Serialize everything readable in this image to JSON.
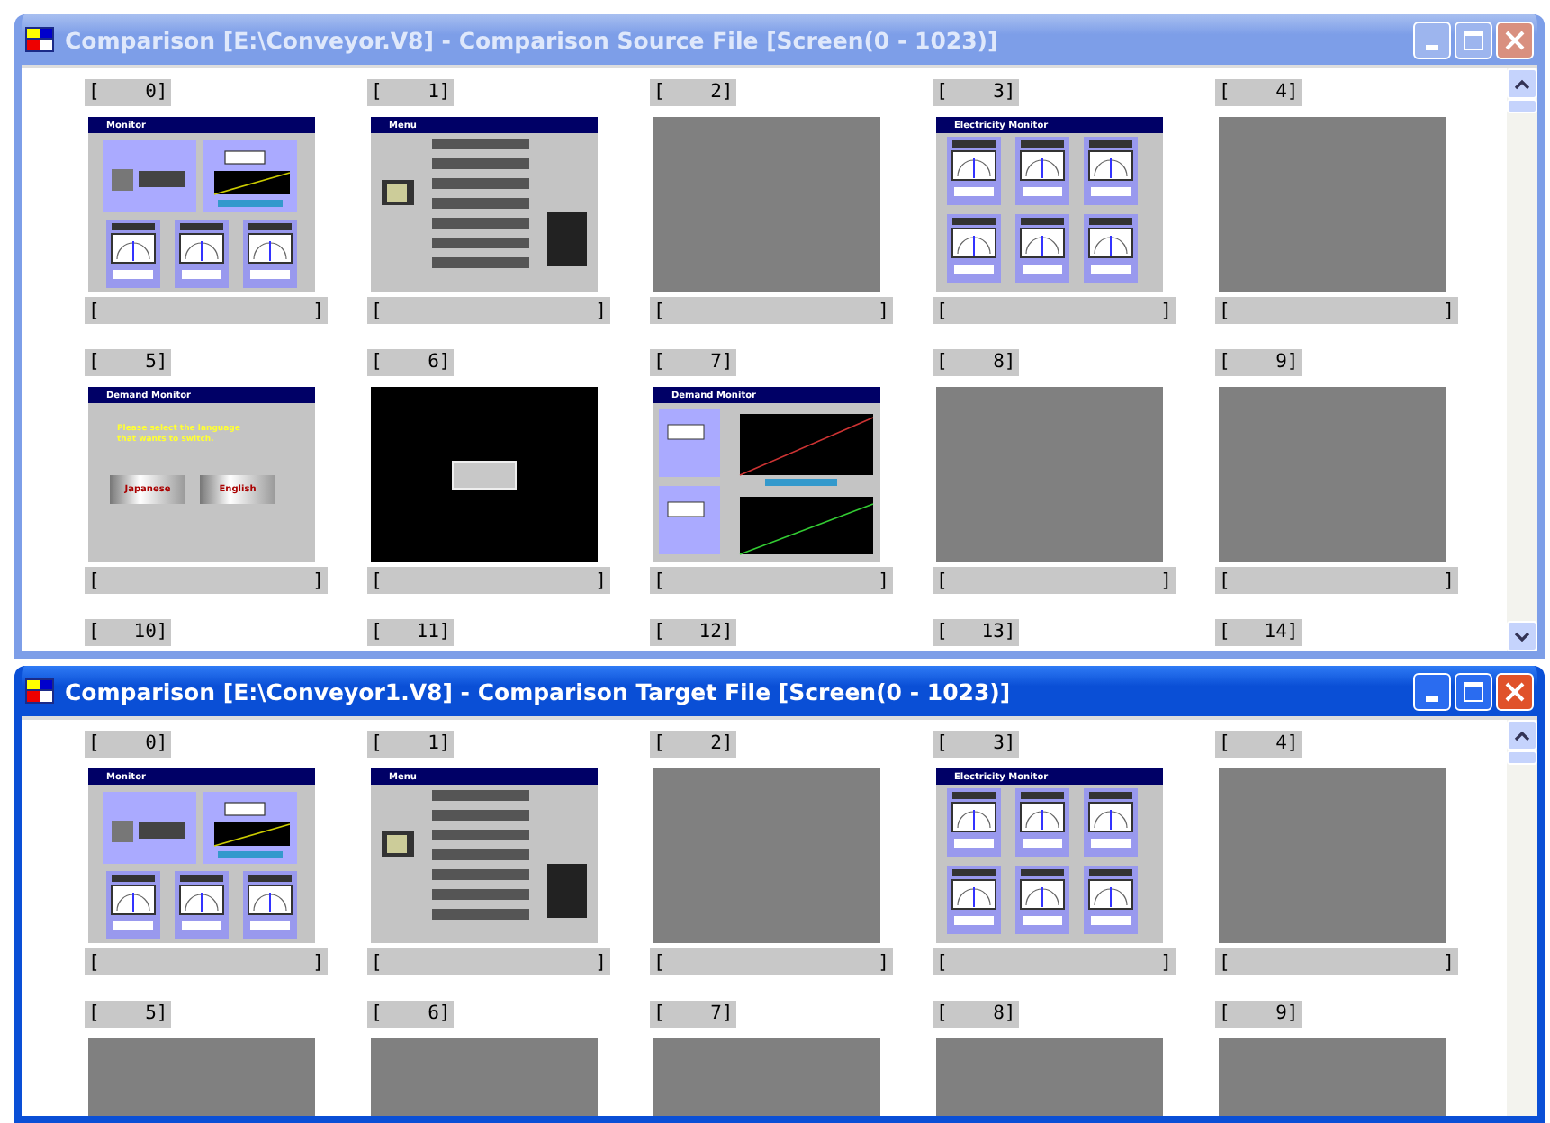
{
  "windows": [
    {
      "title": "Comparison [E:\\Conveyor.V8] - Comparison Source File [Screen(0 - 1023)]",
      "active": false,
      "scroll_down": true,
      "cells": [
        {
          "number": "[    0]",
          "kind": "monitor",
          "screen_title": "Monitor",
          "caption": {
            "open": "[",
            "close": "]"
          }
        },
        {
          "number": "[    1]",
          "kind": "menu",
          "screen_title": "Menu",
          "caption": {
            "open": "[",
            "close": "]"
          }
        },
        {
          "number": "[    2]",
          "kind": "blank",
          "caption": {
            "open": "[",
            "close": "]"
          }
        },
        {
          "number": "[    3]",
          "kind": "meters",
          "screen_title": "Electricity Monitor",
          "caption": {
            "open": "[",
            "close": "]"
          }
        },
        {
          "number": "[    4]",
          "kind": "blank",
          "caption": {
            "open": "[",
            "close": "]"
          }
        },
        {
          "number": "[    5]",
          "kind": "language",
          "screen_title": "Demand Monitor",
          "prompt": "Please select the language\nthat wants to switch.",
          "buttons": [
            "Japanese",
            "English"
          ],
          "caption": {
            "open": "[",
            "close": "]"
          }
        },
        {
          "number": "[    6]",
          "kind": "dark",
          "caption": {
            "open": "[",
            "close": "]"
          }
        },
        {
          "number": "[    7]",
          "kind": "demand",
          "screen_title": "Demand Monitor",
          "caption": {
            "open": "[",
            "close": "]"
          }
        },
        {
          "number": "[    8]",
          "kind": "blank",
          "caption": {
            "open": "[",
            "close": "]"
          }
        },
        {
          "number": "[    9]",
          "kind": "blank",
          "caption": {
            "open": "[",
            "close": "]"
          }
        },
        {
          "number": "[   10]",
          "kind": "hidden"
        },
        {
          "number": "[   11]",
          "kind": "hidden"
        },
        {
          "number": "[   12]",
          "kind": "hidden"
        },
        {
          "number": "[   13]",
          "kind": "hidden"
        },
        {
          "number": "[   14]",
          "kind": "hidden"
        }
      ]
    },
    {
      "title": "Comparison [E:\\Conveyor1.V8] - Comparison Target File [Screen(0 - 1023)]",
      "active": true,
      "scroll_down": false,
      "cells": [
        {
          "number": "[    0]",
          "kind": "monitor",
          "screen_title": "Monitor",
          "caption": {
            "open": "[",
            "close": "]"
          }
        },
        {
          "number": "[    1]",
          "kind": "menu",
          "screen_title": "Menu",
          "caption": {
            "open": "[",
            "close": "]"
          }
        },
        {
          "number": "[    2]",
          "kind": "blank",
          "caption": {
            "open": "[",
            "close": "]"
          }
        },
        {
          "number": "[    3]",
          "kind": "meters",
          "screen_title": "Electricity Monitor",
          "caption": {
            "open": "[",
            "close": "]"
          }
        },
        {
          "number": "[    4]",
          "kind": "blank",
          "caption": {
            "open": "[",
            "close": "]"
          }
        },
        {
          "number": "[    5]",
          "kind": "blank"
        },
        {
          "number": "[    6]",
          "kind": "blank"
        },
        {
          "number": "[    7]",
          "kind": "blank"
        },
        {
          "number": "[    8]",
          "kind": "blank"
        },
        {
          "number": "[    9]",
          "kind": "blank"
        }
      ]
    }
  ]
}
